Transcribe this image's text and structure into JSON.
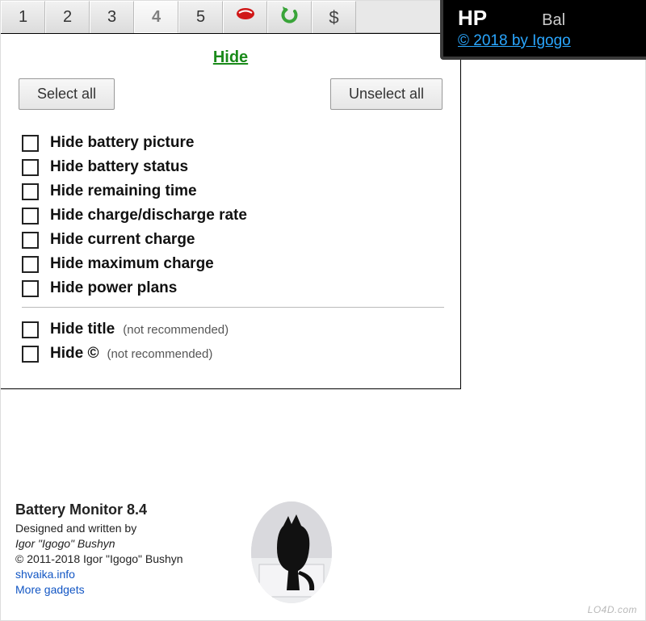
{
  "toolbar": {
    "tabs": [
      "1",
      "2",
      "3",
      "4",
      "5"
    ],
    "active_index": 3,
    "icons": {
      "tongue": "tongue-icon",
      "undo": "undo-icon",
      "dollar": "$"
    }
  },
  "hp_badge": {
    "hp": "HP",
    "bal": "Bal",
    "copyright": "© 2018 by Igogo"
  },
  "panel": {
    "title": "Hide",
    "select_all": "Select all",
    "unselect_all": "Unselect all",
    "options": [
      {
        "label": "Hide battery picture",
        "checked": false
      },
      {
        "label": "Hide battery status",
        "checked": false
      },
      {
        "label": "Hide remaining time",
        "checked": false
      },
      {
        "label": "Hide charge/discharge rate",
        "checked": false
      },
      {
        "label": "Hide current charge",
        "checked": false
      },
      {
        "label": "Hide maximum charge",
        "checked": false
      },
      {
        "label": "Hide power plans",
        "checked": false
      }
    ],
    "extra": [
      {
        "label": "Hide title",
        "note": "(not recommended)",
        "checked": false
      },
      {
        "label": "Hide ©",
        "note": "(not recommended)",
        "checked": false
      }
    ]
  },
  "about": {
    "title": "Battery Monitor 8.4",
    "designed": "Designed and written by",
    "author": "Igor \"Igogo\" Bushyn",
    "copyright": "© 2011-2018 Igor \"Igogo\" Bushyn",
    "link1": "shvaika.info",
    "link2": "More gadgets"
  },
  "watermark": "LO4D.com"
}
